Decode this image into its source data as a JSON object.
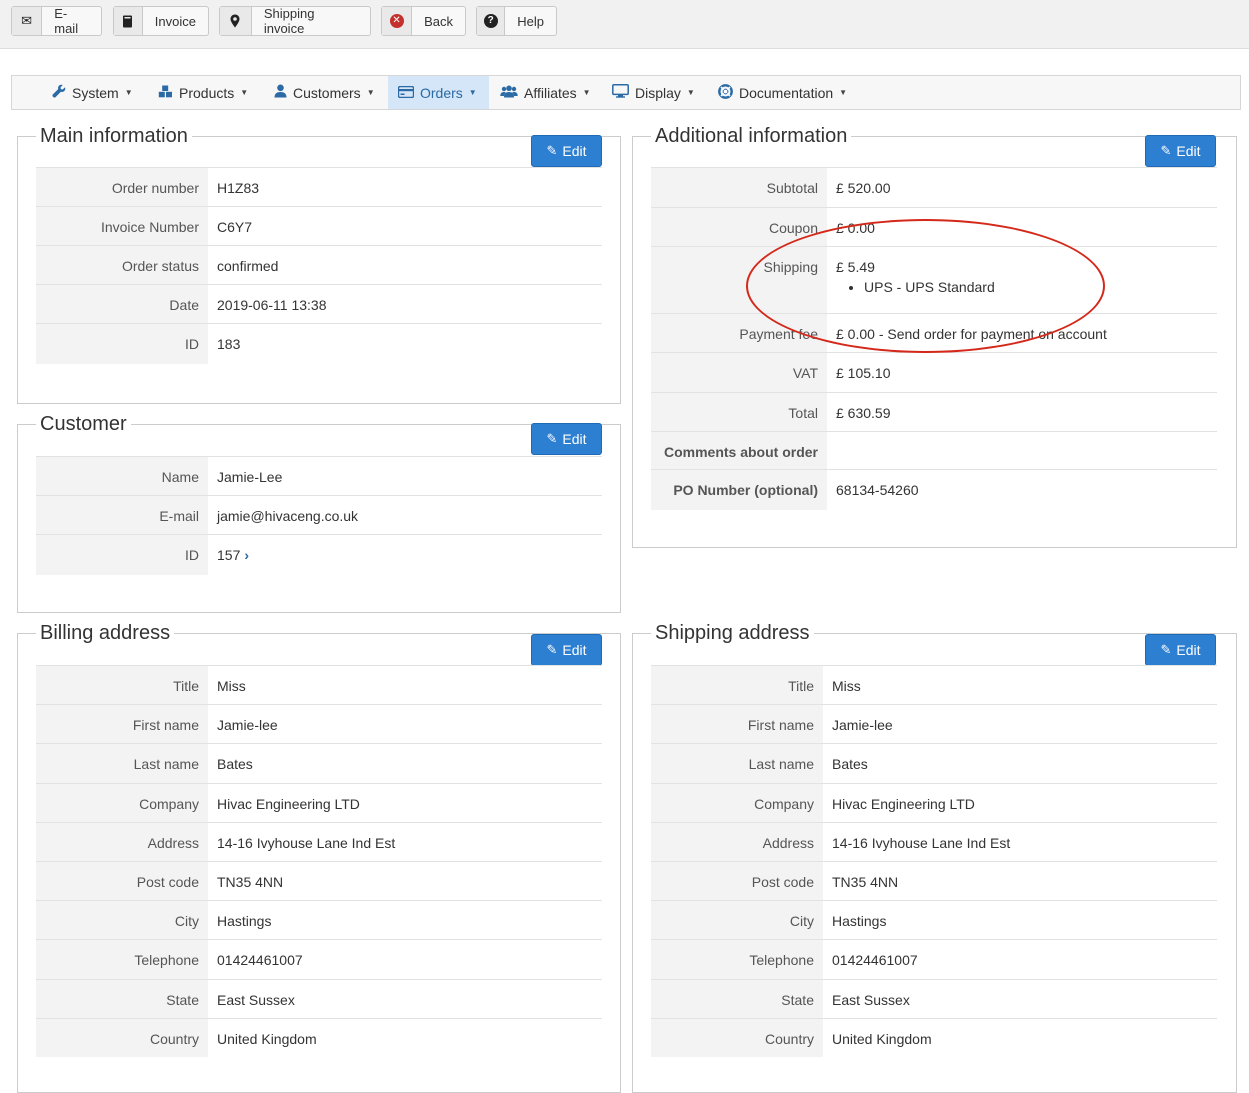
{
  "toolbar": {
    "email_label": "E-mail",
    "invoice_label": "Invoice",
    "shipping_invoice_label": "Shipping invoice",
    "back_label": "Back",
    "help_label": "Help"
  },
  "nav": {
    "items": [
      {
        "label": "System",
        "icon": "wrench-icon"
      },
      {
        "label": "Products",
        "icon": "cubes-icon"
      },
      {
        "label": "Customers",
        "icon": "user-icon"
      },
      {
        "label": "Orders",
        "icon": "credit-card-icon",
        "active": true
      },
      {
        "label": "Affiliates",
        "icon": "users-icon"
      },
      {
        "label": "Display",
        "icon": "monitor-icon"
      },
      {
        "label": "Documentation",
        "icon": "lifebuoy-icon"
      }
    ]
  },
  "edit_label": "Edit",
  "main_info": {
    "title": "Main information",
    "rows": [
      {
        "key": "Order number",
        "value": "H1Z83"
      },
      {
        "key": "Invoice Number",
        "value": "C6Y7"
      },
      {
        "key": "Order status",
        "value": "confirmed"
      },
      {
        "key": "Date",
        "value": "2019-06-11 13:38"
      },
      {
        "key": "ID",
        "value": "183"
      }
    ]
  },
  "customer": {
    "title": "Customer",
    "rows": [
      {
        "key": "Name",
        "value": "Jamie-Lee"
      },
      {
        "key": "E-mail",
        "value": "jamie@hivaceng.co.uk"
      },
      {
        "key": "ID",
        "value": "157"
      }
    ]
  },
  "additional": {
    "title": "Additional information",
    "subtotal_key": "Subtotal",
    "subtotal": "£ 520.00",
    "coupon_key": "Coupon",
    "coupon": "£ 0.00",
    "shipping_key": "Shipping",
    "shipping": "£ 5.49",
    "shipping_method": "UPS - UPS Standard",
    "payment_key": "Payment fee",
    "payment": "£ 0.00 - Send order for payment on account",
    "vat_key": "VAT",
    "vat": "£ 105.10",
    "total_key": "Total",
    "total": "£ 630.59",
    "comments_key": "Comments about order",
    "comments": "",
    "po_key": "PO Number (optional)",
    "po": "68134-54260"
  },
  "billing": {
    "title": "Billing address",
    "rows": [
      {
        "key": "Title",
        "value": "Miss"
      },
      {
        "key": "First name",
        "value": "Jamie-lee"
      },
      {
        "key": "Last name",
        "value": "Bates"
      },
      {
        "key": "Company",
        "value": "Hivac Engineering LTD"
      },
      {
        "key": "Address",
        "value": "14-16 Ivyhouse Lane Ind Est"
      },
      {
        "key": "Post code",
        "value": "TN35 4NN"
      },
      {
        "key": "City",
        "value": "Hastings"
      },
      {
        "key": "Telephone",
        "value": "01424461007"
      },
      {
        "key": "State",
        "value": "East Sussex"
      },
      {
        "key": "Country",
        "value": "United Kingdom"
      }
    ]
  },
  "shipping_addr": {
    "title": "Shipping address",
    "rows": [
      {
        "key": "Title",
        "value": "Miss"
      },
      {
        "key": "First name",
        "value": "Jamie-lee"
      },
      {
        "key": "Last name",
        "value": "Bates"
      },
      {
        "key": "Company",
        "value": "Hivac Engineering LTD"
      },
      {
        "key": "Address",
        "value": "14-16 Ivyhouse Lane Ind Est"
      },
      {
        "key": "Post code",
        "value": "TN35 4NN"
      },
      {
        "key": "City",
        "value": "Hastings"
      },
      {
        "key": "Telephone",
        "value": "01424461007"
      },
      {
        "key": "State",
        "value": "East Sussex"
      },
      {
        "key": "Country",
        "value": "United Kingdom"
      }
    ]
  },
  "colors": {
    "accent": "#2d7fd2",
    "nav_active_bg": "#d4e6f7",
    "annotation": "#d4291a"
  }
}
